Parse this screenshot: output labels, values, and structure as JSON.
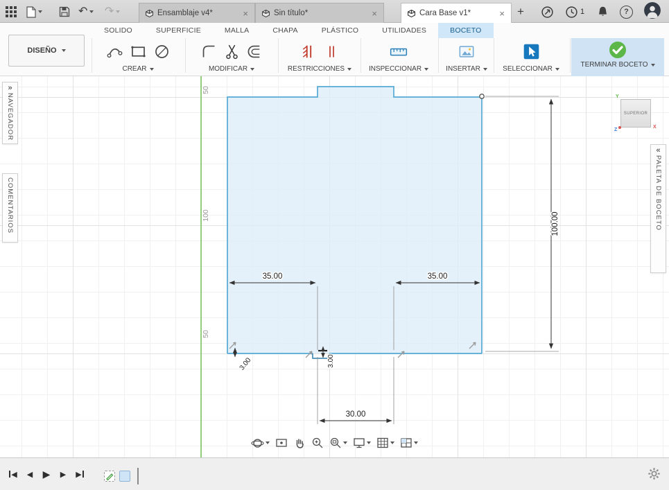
{
  "colors": {
    "accent_blue": "#0696d7",
    "tab_highlight": "#cfe7f8",
    "finish_panel_bg": "#cfe3f5",
    "check_green": "#5cb648",
    "axis_green": "#6abf4b",
    "sketch_line_blue": "#55aad5",
    "profile_fill_blue": "#ddeef9",
    "constraint_red": "#c0392b"
  },
  "titlebar": {
    "doc_tabs": [
      {
        "label": "Ensamblaje v4*"
      },
      {
        "label": "Sin título*"
      },
      {
        "label": "Cara Base v1*"
      }
    ],
    "job_count": "1"
  },
  "ribbon": {
    "workspace_label": "DISEÑO",
    "tabs": [
      "SOLIDO",
      "SUPERFICIE",
      "MALLA",
      "CHAPA",
      "PLÁSTICO",
      "UTILIDADES",
      "BOCETO"
    ],
    "active_tab": "BOCETO",
    "group_labels": {
      "crear": "CREAR",
      "modificar": "MODIFICAR",
      "restricciones": "RESTRICCIONES",
      "inspeccionar": "INSPECCIONAR",
      "insertar": "INSERTAR",
      "seleccionar": "SELECCIONAR"
    },
    "finish_label": "TERMINAR BOCETO"
  },
  "side_panels": {
    "navegador": "NAVEGADOR",
    "comentarios": "COMENTARIOS",
    "paleta": "PALETA DE BOCETO"
  },
  "viewcube": {
    "face_label": "SUPERIOR",
    "axis_x": "X",
    "axis_y": "Y",
    "axis_z": "Z"
  },
  "sketch": {
    "grid_labels": {
      "top": "50",
      "middle": "100",
      "bottom": "50"
    },
    "dimensions": {
      "width_left": "35.00",
      "width_right": "35.00",
      "width_bottom": "30.00",
      "height_right": "100.00",
      "thickness_a": "3.00",
      "thickness_b": "3.00"
    }
  }
}
